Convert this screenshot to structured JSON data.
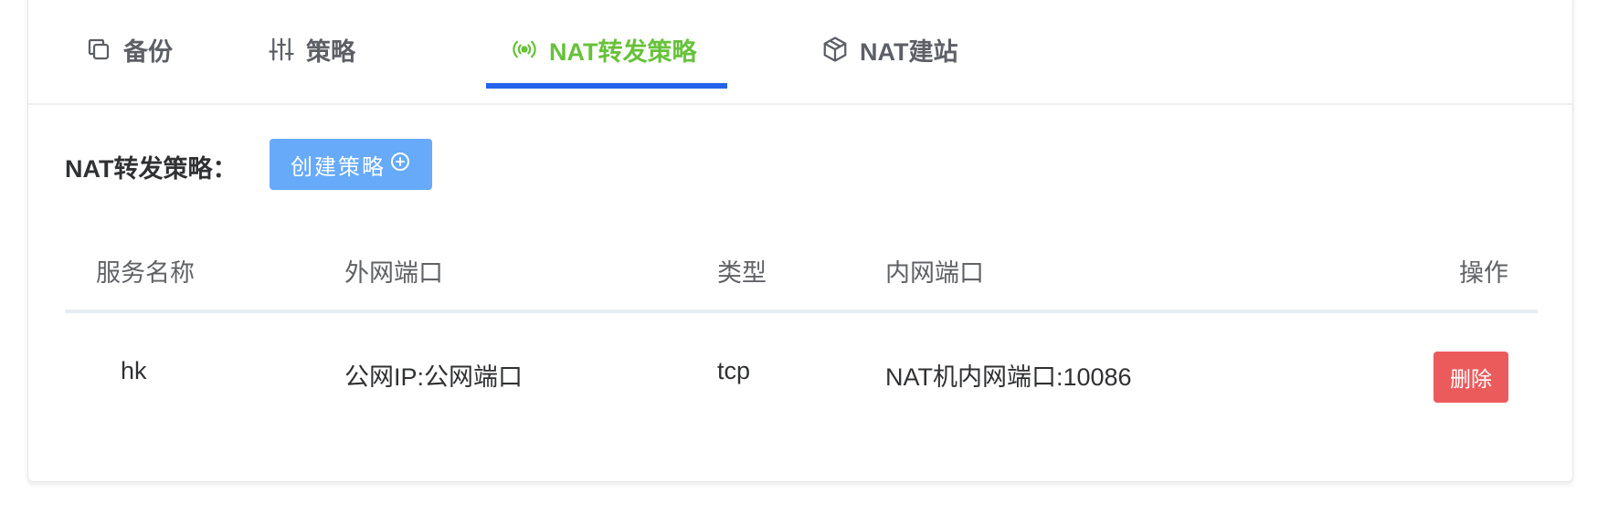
{
  "tabs": [
    {
      "label": "备份",
      "icon": "copy-icon"
    },
    {
      "label": "策略",
      "icon": "sliders-icon"
    },
    {
      "label": "NAT转发策略",
      "icon": "broadcast-icon"
    },
    {
      "label": "NAT建站",
      "icon": "box-icon"
    }
  ],
  "active_tab": "NAT转发策略",
  "colors": {
    "active_tab": "#67c23a",
    "indicator": "#2563eb",
    "primary_button": "#66aaf9",
    "danger_button": "#ec5b5c"
  },
  "toolbar": {
    "label": "NAT转发策略：",
    "create_button": "创建策略",
    "create_icon": "plus-circle-icon"
  },
  "table": {
    "headers": {
      "name": "服务名称",
      "external_port": "外网端口",
      "type": "类型",
      "internal_port": "内网端口",
      "action": "操作"
    },
    "rows": [
      {
        "name": "hk",
        "external_port": "公网IP:公网端口",
        "type": "tcp",
        "internal_port": "NAT机内网端口:10086",
        "action": "删除"
      }
    ]
  }
}
